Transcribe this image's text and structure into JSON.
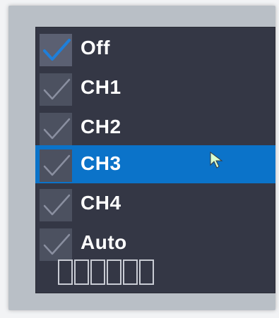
{
  "menu": {
    "items": [
      {
        "label": "Off",
        "checked": true,
        "selected": false
      },
      {
        "label": "CH1",
        "checked": false,
        "selected": false
      },
      {
        "label": "CH2",
        "checked": false,
        "selected": false
      },
      {
        "label": "CH3",
        "checked": false,
        "selected": true
      },
      {
        "label": "CH4",
        "checked": false,
        "selected": false
      },
      {
        "label": "Auto",
        "checked": false,
        "selected": false
      }
    ],
    "footer_glyphs": [
      "□",
      "□",
      "□",
      "□",
      "□",
      "□"
    ]
  },
  "colors": {
    "panel_bg": "#343745",
    "highlight": "#0b73c9",
    "check_active": "#1f7fd9",
    "check_inactive": "#8a8fa0",
    "text": "#ffffff"
  },
  "icons": {
    "check": "check-icon",
    "cursor": "mouse-pointer-icon"
  }
}
